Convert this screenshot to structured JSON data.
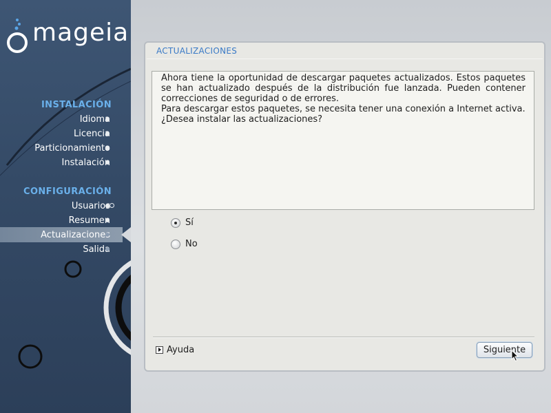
{
  "sidebar": {
    "logo_text": "mageia",
    "sections": [
      {
        "title": "INSTALACIÓN",
        "items": [
          {
            "label": "Idioma",
            "state": "done"
          },
          {
            "label": "Licencia",
            "state": "done"
          },
          {
            "label": "Particionamiento",
            "state": "done"
          },
          {
            "label": "Instalación",
            "state": "done"
          }
        ]
      },
      {
        "title": "CONFIGURACIÓN",
        "items": [
          {
            "label": "Usuarios",
            "state": "done"
          },
          {
            "label": "Resumen",
            "state": "done"
          },
          {
            "label": "Actualizaciones",
            "state": "current"
          },
          {
            "label": "Salida",
            "state": "pending"
          }
        ]
      }
    ]
  },
  "page": {
    "title": "ACTUALIZACIONES",
    "message": [
      "Ahora tiene la oportunidad de descargar paquetes actualizados. Estos paquetes se han actualizado después de la distribución fue lanzada. Pueden contener correcciones de seguridad o de errores.",
      "Para descargar estos paquetes, se necesita tener una conexión a Internet activa.",
      "¿Desea instalar las actualizaciones?"
    ],
    "options": [
      {
        "label": "Sí",
        "checked": true
      },
      {
        "label": "No",
        "checked": false
      }
    ],
    "help_label": "Ayuda",
    "next_label": "Siguiente"
  },
  "colors": {
    "accent": "#3a7ac6",
    "section_title": "#6ab0ea",
    "sidebar_bg": "#344a66"
  }
}
